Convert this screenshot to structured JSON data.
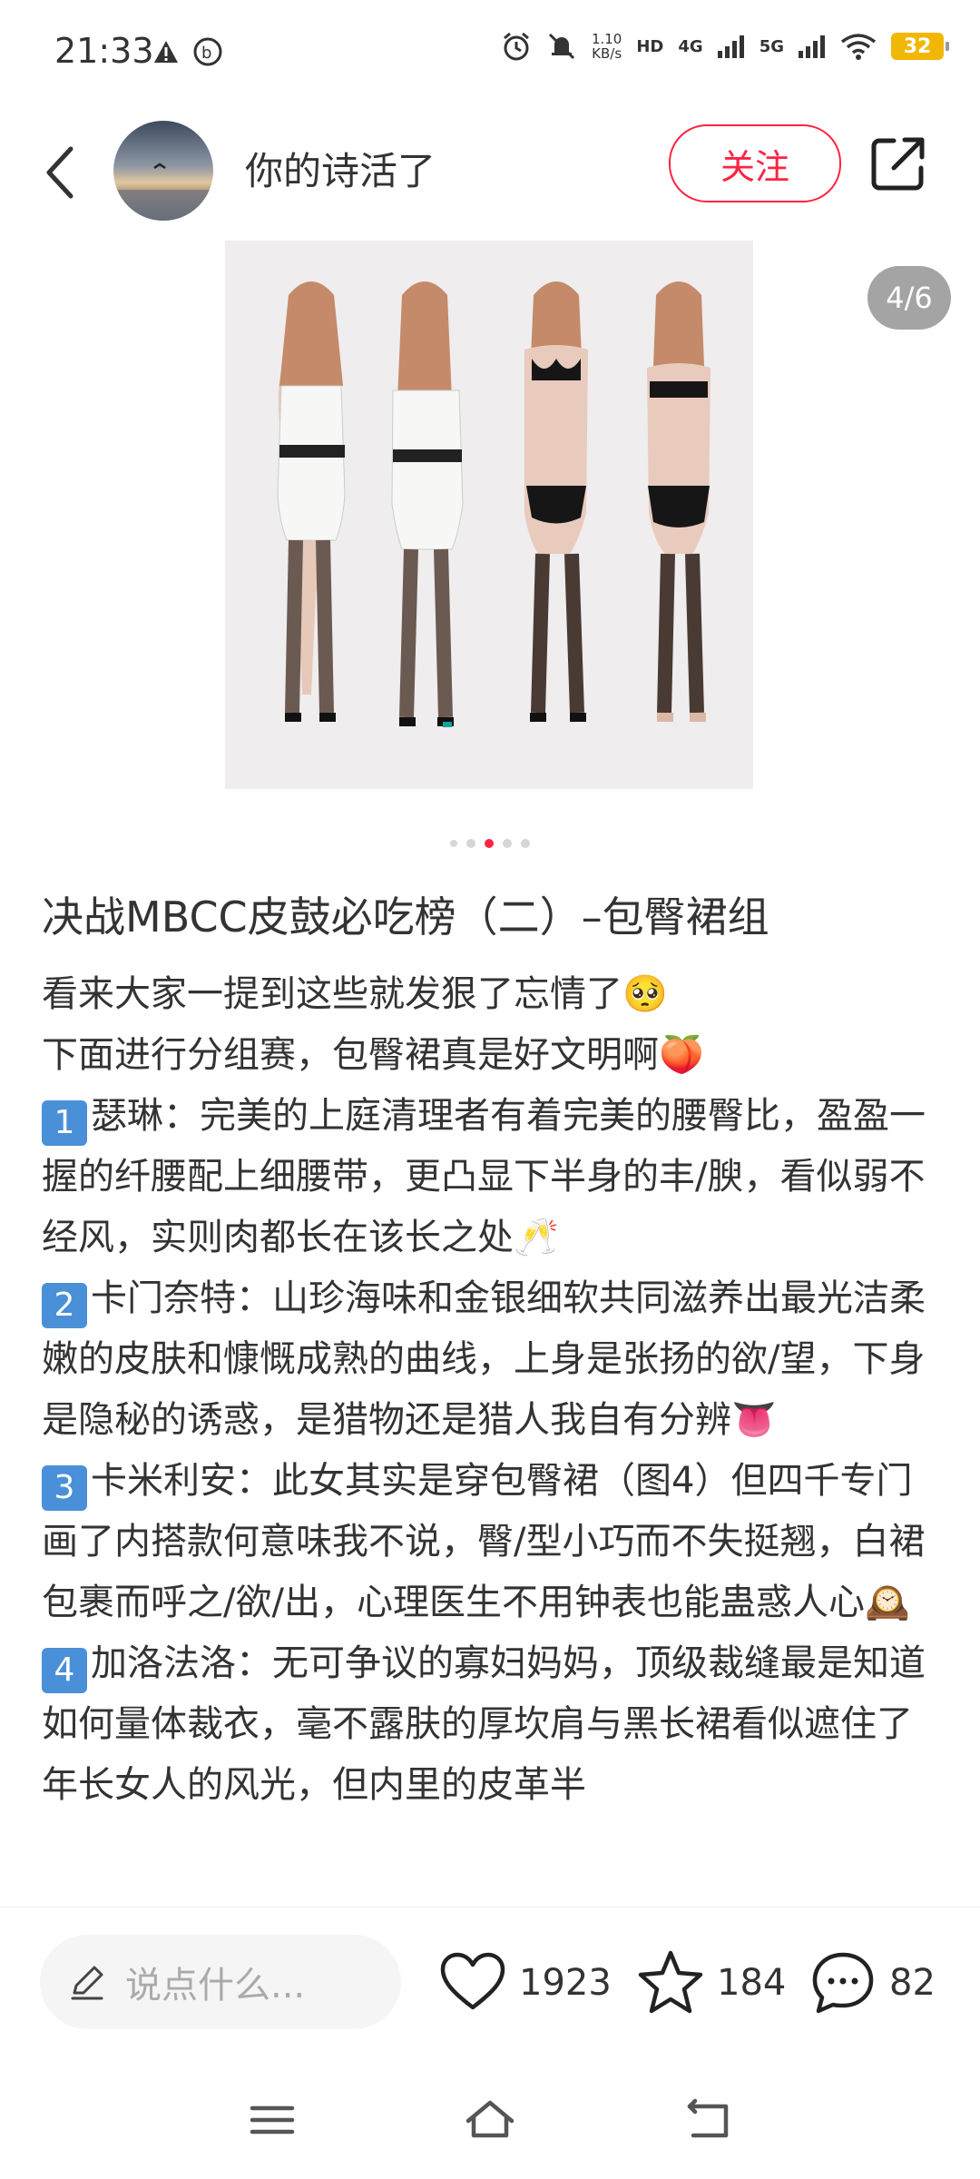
{
  "status": {
    "time": "21:33",
    "speed_value": "1.10",
    "speed_unit": "KB/s",
    "hd": "HD",
    "net1": "4G",
    "net2": "5G",
    "battery": "32"
  },
  "header": {
    "author": "你的诗活了",
    "follow": "关注"
  },
  "image": {
    "counter": "4/6",
    "dots_total": 5,
    "dots_active": 3
  },
  "post": {
    "title": "决战MBCC皮鼓必吃榜（二）–包臀裙组",
    "lines": [
      "看来大家一提到这些就发狠了忘情了🥺",
      "下面进行分组赛，包臀裙真是好文明啊🍑",
      "瑟琳：完美的上庭清理者有着完美的腰臀比，盈盈一握的纤腰配上细腰带，更凸显下半身的丰/腴，看似弱不经风，实则肉都长在该长之处🥂",
      "卡门奈特：山珍海味和金银细软共同滋养出最光洁柔嫩的皮肤和慷慨成熟的曲线，上身是张扬的欲/望，下身是隐秘的诱惑，是猎物还是猎人我自有分辨👅",
      "卡米利安：此女其实是穿包臀裙（图4）但四千专门画了内搭款何意味我不说，臀/型小巧而不失挺翘，白裙包裹而呼之/欲/出，心理医生不用钟表也能蛊惑人心🕰️",
      "加洛法洛：无可争议的寡妇妈妈，顶级裁缝最是知道如何量体裁衣，毫不露肤的厚坎肩与黑长裙看似遮住了年长女人的风光，但内里的皮革半"
    ],
    "nums": [
      "1",
      "2",
      "3",
      "4"
    ]
  },
  "bottom": {
    "placeholder": "说点什么...",
    "likes": "1923",
    "favorites": "184",
    "comments": "82"
  }
}
